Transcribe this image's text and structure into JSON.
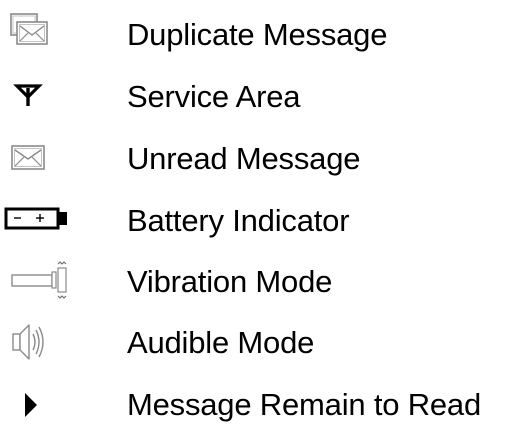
{
  "legend": {
    "items": [
      {
        "icon": "duplicate-message-icon",
        "label": "Duplicate Message"
      },
      {
        "icon": "antenna-icon",
        "label": "Service Area"
      },
      {
        "icon": "envelope-icon",
        "label": "Unread Message"
      },
      {
        "icon": "battery-icon",
        "label": "Battery Indicator"
      },
      {
        "icon": "vibration-icon",
        "label": "Vibration Mode"
      },
      {
        "icon": "speaker-icon",
        "label": "Audible Mode"
      },
      {
        "icon": "play-arrow-icon",
        "label": "Message Remain to Read"
      }
    ]
  }
}
